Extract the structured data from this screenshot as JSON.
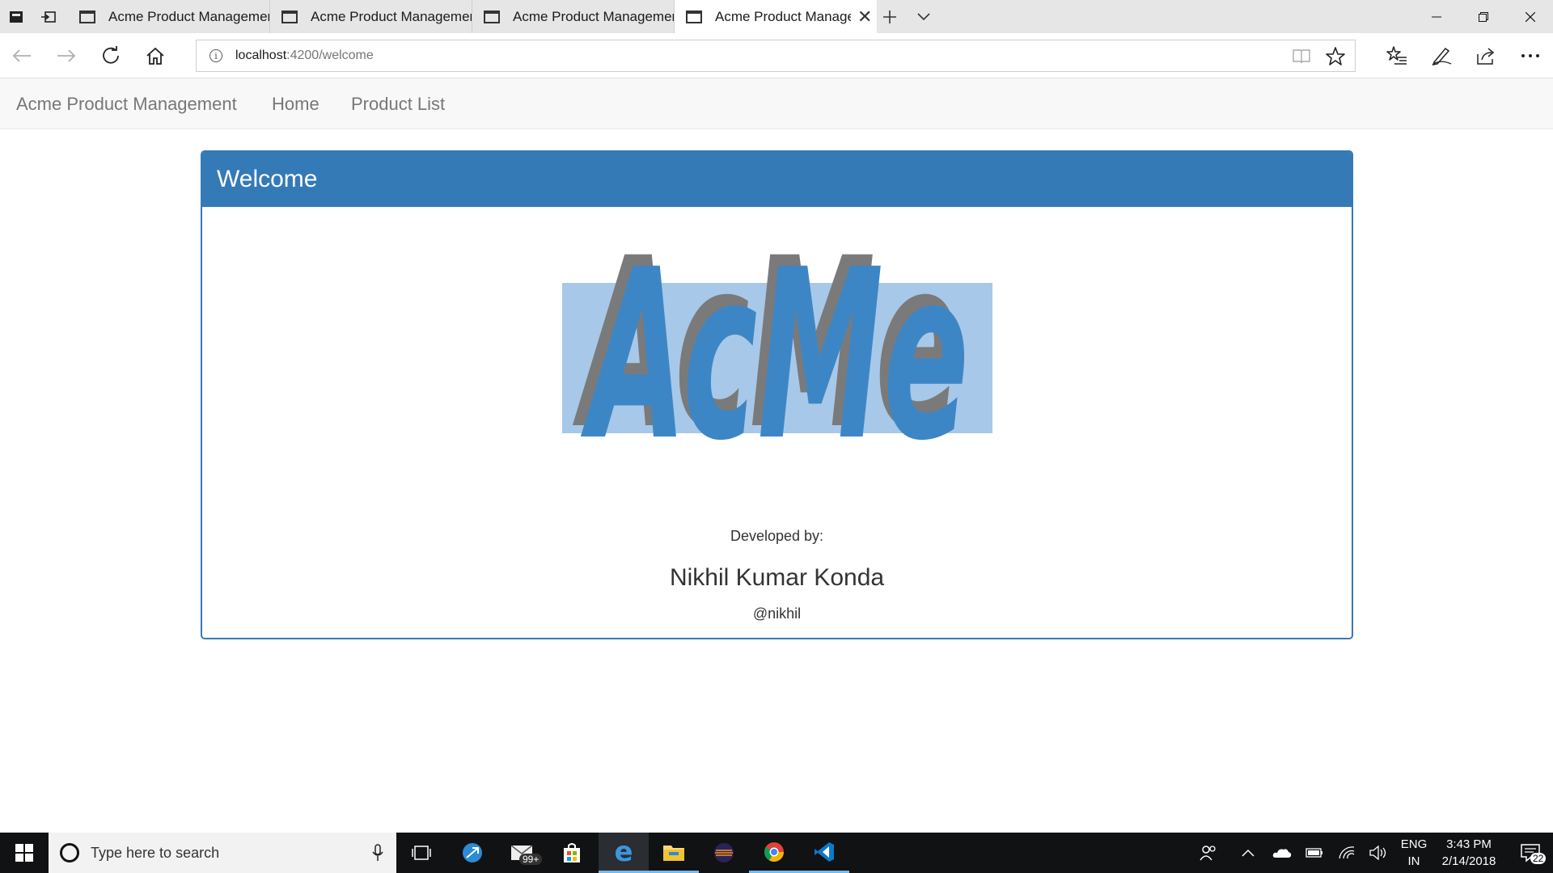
{
  "browser": {
    "tabs": [
      {
        "title": "Acme Product Management"
      },
      {
        "title": "Acme Product Management"
      },
      {
        "title": "Acme Product Management"
      },
      {
        "title": "Acme Product Manager",
        "active": true
      }
    ],
    "url_host": "localhost",
    "url_path": ":4200/welcome",
    "icons": [
      "tab-actions-icon",
      "set-aside-tabs-icon",
      "new-tab-icon",
      "tab-preview-icon",
      "minimize-icon",
      "restore-icon",
      "close-icon",
      "back-icon",
      "forward-icon",
      "refresh-icon",
      "home-icon",
      "site-info-icon",
      "reading-view-icon",
      "favorite-star-icon",
      "favorites-hub-icon",
      "web-note-icon",
      "share-icon",
      "more-icon"
    ]
  },
  "app": {
    "brand": "Acme Product Management",
    "nav": [
      "Home",
      "Product List"
    ],
    "panel_title": "Welcome",
    "logo_text": "AcMe",
    "developed_by_label": "Developed by:",
    "developer_name": "Nikhil Kumar Konda",
    "developer_handle": "@nikhil",
    "accent_color": "#337ab7"
  },
  "taskbar": {
    "search_placeholder": "Type here to search",
    "mail_badge": "99+",
    "language": "ENG",
    "region": "IN",
    "time": "3:43 PM",
    "date": "2/14/2018",
    "notifications_count": "22"
  }
}
